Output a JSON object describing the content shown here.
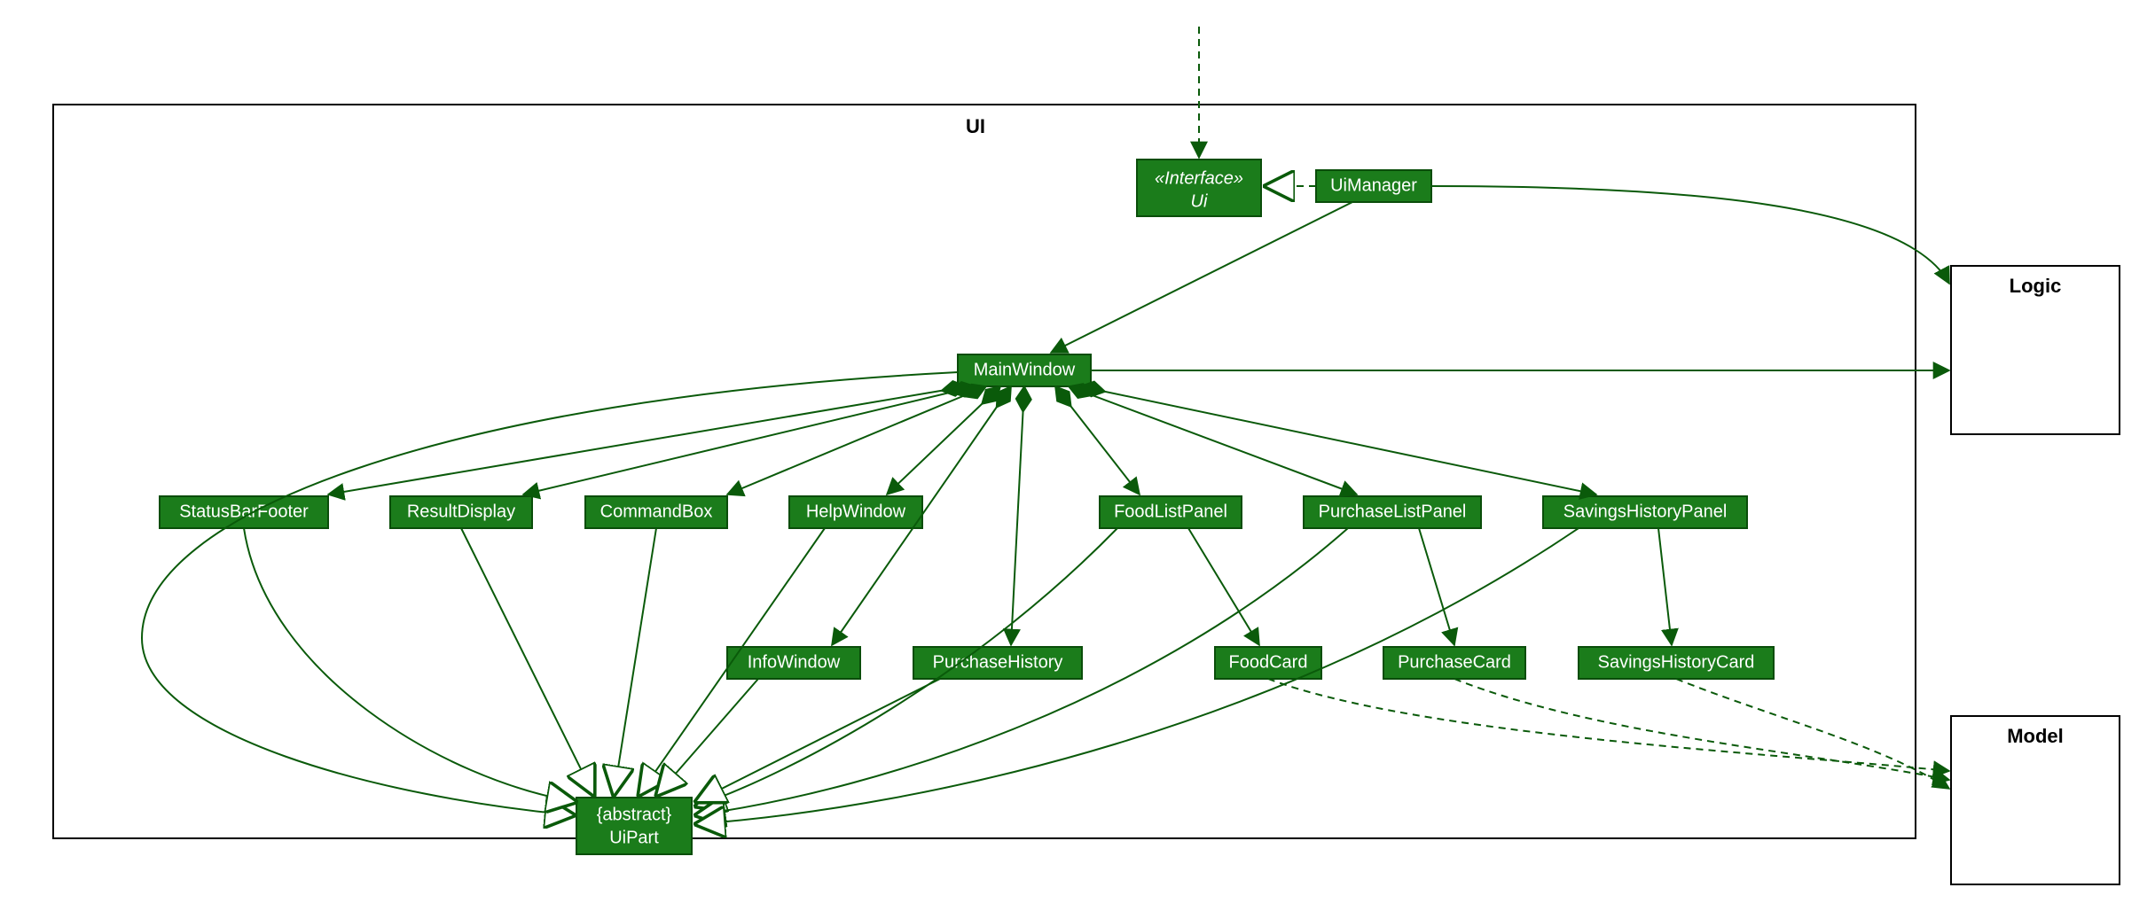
{
  "packages": {
    "ui": "UI",
    "logic": "Logic",
    "model": "Model"
  },
  "classes": {
    "uiInterface": {
      "stereotype": "«Interface»",
      "name": "Ui"
    },
    "uiManager": "UiManager",
    "mainWindow": "MainWindow",
    "statusBarFooter": "StatusBarFooter",
    "resultDisplay": "ResultDisplay",
    "commandBox": "CommandBox",
    "helpWindow": "HelpWindow",
    "foodListPanel": "FoodListPanel",
    "purchaseListPanel": "PurchaseListPanel",
    "savingsHistoryPanel": "SavingsHistoryPanel",
    "infoWindow": "InfoWindow",
    "purchaseHistory": "PurchaseHistory",
    "foodCard": "FoodCard",
    "purchaseCard": "PurchaseCard",
    "savingsHistoryCard": "SavingsHistoryCard",
    "uiPart": {
      "stereotype": "{abstract}",
      "name": "UiPart"
    }
  }
}
